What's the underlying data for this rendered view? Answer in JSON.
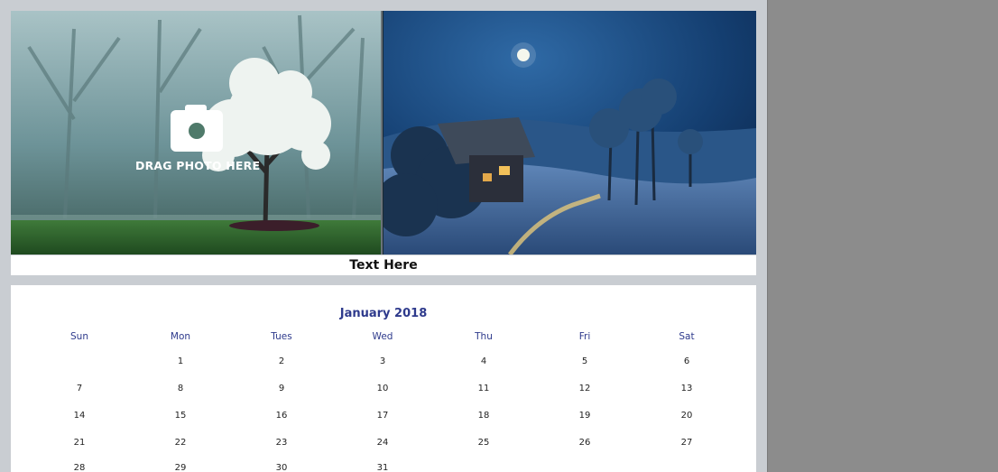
{
  "photos": {
    "drop_hint": "DRAG PHOTO HERE",
    "left_icon": "camera-icon"
  },
  "caption": "Text Here",
  "calendar": {
    "title": "January 2018",
    "weekdays": [
      "Sun",
      "Mon",
      "Tues",
      "Wed",
      "Thu",
      "Fri",
      "Sat"
    ],
    "weeks": [
      [
        "",
        "1",
        "2",
        "3",
        "4",
        "5",
        "6"
      ],
      [
        "7",
        "8",
        "9",
        "10",
        "11",
        "12",
        "13"
      ],
      [
        "14",
        "15",
        "16",
        "17",
        "18",
        "19",
        "20"
      ],
      [
        "21",
        "22",
        "23",
        "24",
        "25",
        "26",
        "27"
      ],
      [
        "28",
        "29",
        "30",
        "31",
        "",
        "",
        ""
      ]
    ]
  }
}
